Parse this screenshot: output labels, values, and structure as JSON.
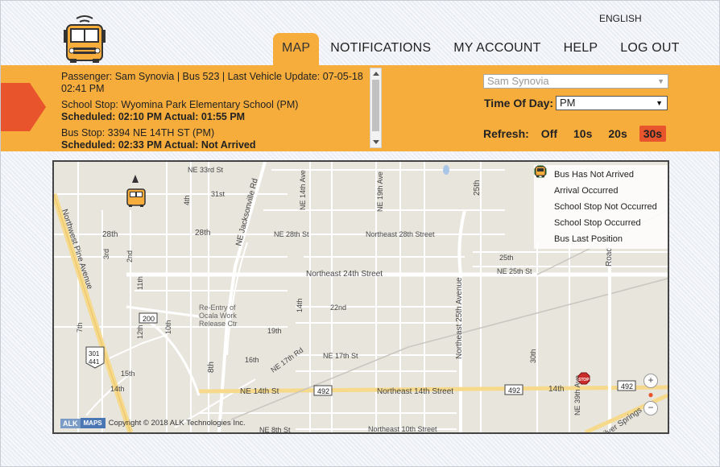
{
  "header": {
    "language": "ENGLISH",
    "nav": [
      {
        "label": "MAP",
        "active": true
      },
      {
        "label": "NOTIFICATIONS",
        "active": false
      },
      {
        "label": "MY ACCOUNT",
        "active": false
      },
      {
        "label": "HELP",
        "active": false
      },
      {
        "label": "LOG OUT",
        "active": false
      }
    ]
  },
  "info": {
    "passenger_line": "Passenger: Sam Synovia | Bus 523 | Last Vehicle Update: 07-05-18 02:41 PM",
    "school_stop": "School Stop: Wyomina Park Elementary School (PM)",
    "school_sched": "Scheduled: 02:10 PM Actual: 01:55 PM",
    "bus_stop": "Bus Stop: 3394 NE 14TH ST (PM)",
    "bus_sched": "Scheduled: 02:33 PM Actual: Not Arrived"
  },
  "controls": {
    "passenger_select": "Sam Synovia",
    "time_of_day_label": "Time Of Day:",
    "time_of_day_value": "PM",
    "refresh_label": "Refresh:",
    "refresh_options": [
      {
        "label": "Off",
        "active": false
      },
      {
        "label": "10s",
        "active": false
      },
      {
        "label": "20s",
        "active": false
      },
      {
        "label": "30s",
        "active": true
      }
    ]
  },
  "legend": [
    {
      "icon": "stop-sign-icon",
      "label": "Bus Has Not Arrived"
    },
    {
      "icon": "arrival-icon",
      "label": "Arrival Occurred"
    },
    {
      "icon": "school-stop-not-occurred-icon",
      "label": "School Stop Not Occurred"
    },
    {
      "icon": "school-stop-occurred-icon",
      "label": "School Stop Occurred"
    },
    {
      "icon": "bus-icon",
      "label": "Bus Last Position"
    }
  ],
  "map": {
    "labels": {
      "ne33": "NE 33rd St",
      "s31": "31st",
      "s28": "28th",
      "s28b": "28th",
      "ne28": "NE 28th St",
      "ne28b": "Northeast 28th Street",
      "s25": "25th",
      "ne25": "NE 25th St",
      "ne24": "Northeast 24th Street",
      "s22": "22nd",
      "s19": "19th",
      "s16": "16th",
      "ne17st": "NE 17th St",
      "ne17rd": "NE 17th Rd",
      "s15": "15th",
      "s14": "14th",
      "ne14": "NE 14th St",
      "ne14b": "Northeast 14th Street",
      "ne10": "Northeast 10th Street",
      "ne8": "NE 8th St",
      "nwpine": "Northwest Pine Avenue",
      "nejax": "NE Jacksonville Rd",
      "ne14ave": "NE 14th Ave",
      "ne19ave": "NE 19th Ave",
      "ne25ave": "Northeast 25th Avenue",
      "s25th": "25th",
      "s30": "30th",
      "ne39": "NE 39th Ave",
      "road": "Road",
      "silver": "Silver Springs",
      "reentry": "Re-Entry of\nOcala Work\nRelease Ctr",
      "hwy200": "200",
      "hwy492a": "492",
      "hwy492b": "492",
      "hwy492c": "492",
      "hwy492d": "492",
      "us301": "301",
      "us441": "441",
      "s4": "4th",
      "s3": "3rd",
      "s2": "2nd",
      "s8": "8th",
      "s7": "7th",
      "s10": "10th",
      "s11": "11th",
      "s9": "9th",
      "s12": "12th"
    },
    "attribution": "Copyright © 2018 ALK Technologies Inc.",
    "alk": "ALK",
    "maps": "MAPS",
    "zoom_in": "+",
    "zoom_out": "−",
    "stop_text": "STOP"
  },
  "colors": {
    "accent": "#f7ad3c",
    "arrow": "#e8552c",
    "active_refresh": "#e8552c",
    "major_road": "#f6d98a",
    "minor_road": "#ffffff",
    "map_bg": "#e8e5dd"
  }
}
